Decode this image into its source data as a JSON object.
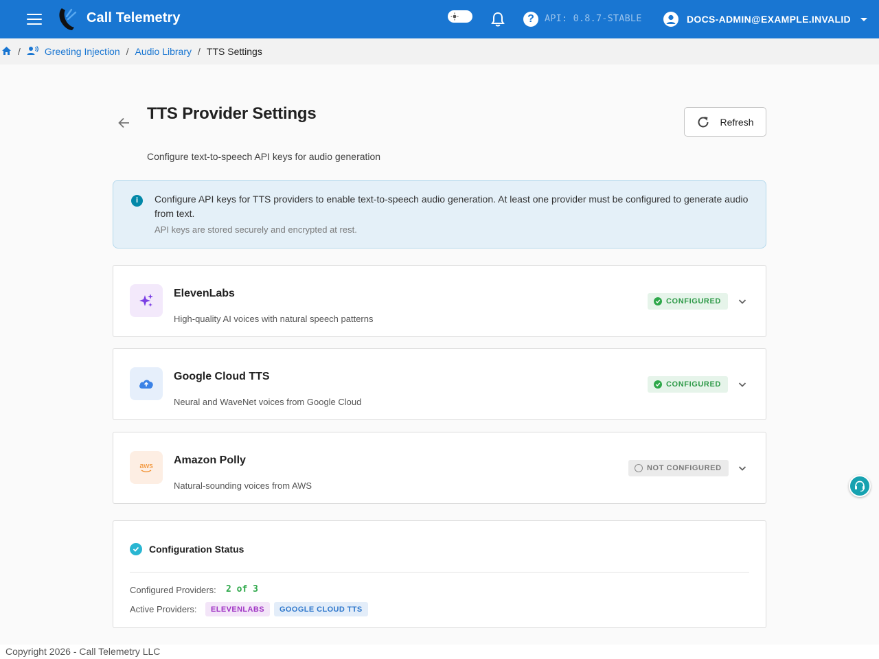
{
  "app": {
    "title": "Call Telemetry",
    "api_version": "API: 0.8.7-STABLE",
    "user": "DOCS-ADMIN@EXAMPLE.INVALID",
    "brand_color": "#1976d2"
  },
  "icons": {
    "menu": "hamburger-menu-icon",
    "theme": "theme-toggle-icon",
    "notifications": "bell-icon",
    "help": "help-icon",
    "user": "account-circle-icon",
    "home": "home-icon",
    "greeting": "greeting-injection-icon",
    "back": "arrow-back-icon",
    "refresh": "refresh-icon",
    "info": "info-icon",
    "support": "support-agent-icon"
  },
  "breadcrumb": {
    "greeting": "Greeting Injection",
    "library": "Audio Library",
    "current": "TTS Settings"
  },
  "page": {
    "title": "TTS Provider Settings",
    "subtitle": "Configure text-to-speech API keys for audio generation",
    "refresh_label": "Refresh"
  },
  "info": {
    "text": "Configure API keys for TTS providers to enable text-to-speech audio generation. At least one provider must be configured to generate audio from text.",
    "note": "API keys are stored securely and encrypted at rest."
  },
  "providers": [
    {
      "name": "ElevenLabs",
      "description": "High-quality AI voices with natural speech patterns",
      "status": "CONFIGURED",
      "configured": true,
      "logo": "sparkle-icon",
      "logo_color": "#7b3fe4"
    },
    {
      "name": "Google Cloud TTS",
      "description": "Neural and WaveNet voices from Google Cloud",
      "status": "CONFIGURED",
      "configured": true,
      "logo": "cloud-icon",
      "logo_color": "#3b82e6"
    },
    {
      "name": "Amazon Polly",
      "description": "Natural-sounding voices from AWS",
      "status": "NOT CONFIGURED",
      "configured": false,
      "logo": "aws-logo",
      "logo_text": "aws",
      "logo_color": "#f08a24"
    }
  ],
  "status": {
    "title": "Configuration Status",
    "configured_label": "Configured Providers:",
    "configured_value": "2 of 3",
    "active_label": "Active Providers:",
    "active": [
      {
        "label": "ELEVENLABS",
        "color": "#a033c4",
        "bg": "#f3e5f8"
      },
      {
        "label": "GOOGLE CLOUD TTS",
        "color": "#2f78cc",
        "bg": "#e3edf9"
      }
    ]
  },
  "footer": "Copyright 2026 - Call Telemetry LLC"
}
